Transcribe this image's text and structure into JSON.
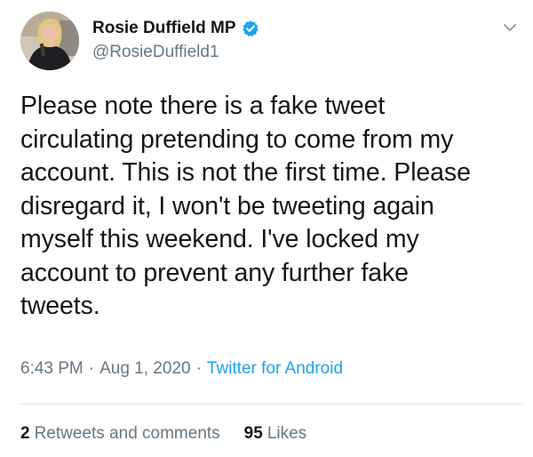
{
  "tweet": {
    "display_name": "Rosie Duffield MP",
    "handle": "@RosieDuffield1",
    "verified_icon": "verified-badge-icon",
    "menu_icon": "chevron-down-icon",
    "text": "Please note there is a fake tweet\ncirculating pretending to come from my\naccount. This is not the first time. Please\ndisregard it, I won't be tweeting again\nmyself this weekend. I've locked my\naccount to prevent any further fake\ntweets.",
    "time": "6:43 PM",
    "date": "Aug 1, 2020",
    "separator": "·",
    "source": "Twitter for Android",
    "retweets_count": "2",
    "retweets_label": "Retweets and comments",
    "likes_count": "95",
    "likes_label": "Likes"
  },
  "colors": {
    "text": "#14171a",
    "secondary": "#657786",
    "accent": "#1da1f2",
    "divider": "#e1e8ed"
  }
}
